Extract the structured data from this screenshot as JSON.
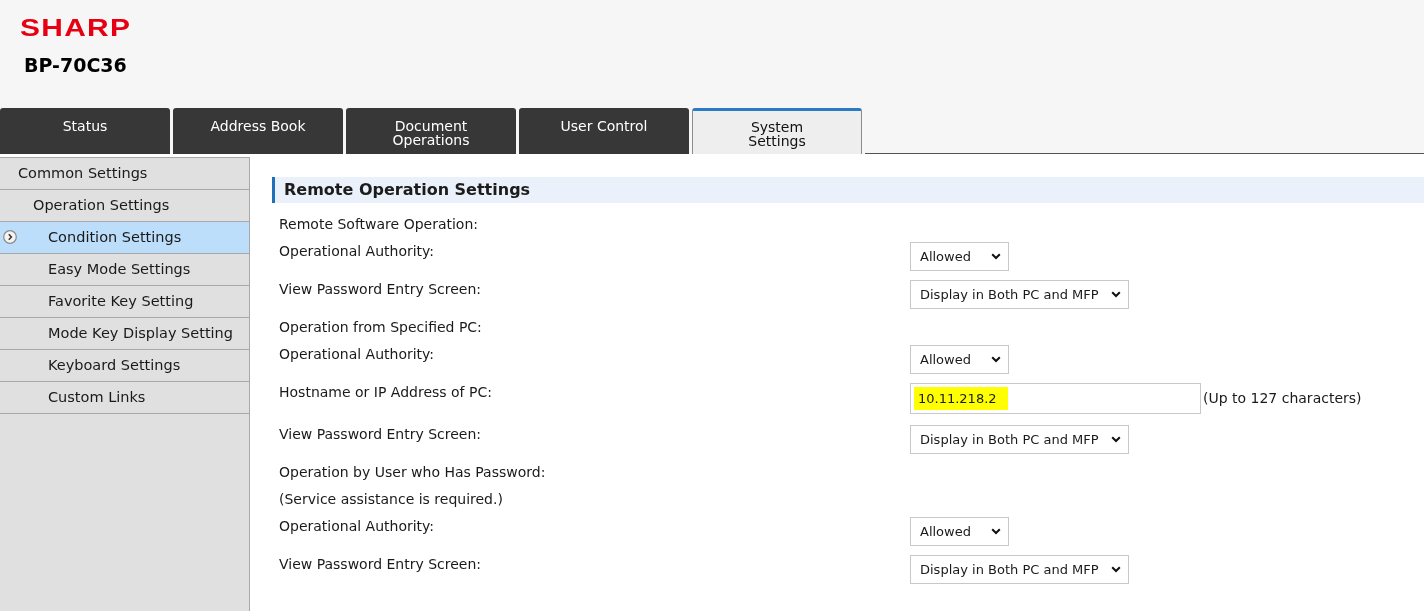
{
  "header": {
    "logo": "SHARP",
    "model": "BP-70C36"
  },
  "tabs": [
    {
      "label": "Status",
      "selected": false
    },
    {
      "label": "Address Book",
      "selected": false
    },
    {
      "label": "Document\nOperations",
      "selected": false
    },
    {
      "label": "User Control",
      "selected": false
    },
    {
      "label": "System\nSettings",
      "selected": true
    }
  ],
  "sidebar": {
    "items": [
      {
        "label": "Common Settings",
        "selected": false,
        "children": [
          {
            "label": "Operation Settings",
            "selected": false,
            "children": [
              {
                "label": "Condition Settings",
                "selected": true
              },
              {
                "label": "Easy Mode Settings",
                "selected": false
              },
              {
                "label": "Favorite Key Setting",
                "selected": false
              },
              {
                "label": "Mode Key Display Setting",
                "selected": false
              },
              {
                "label": "Keyboard Settings",
                "selected": false
              },
              {
                "label": "Custom Links",
                "selected": false
              }
            ]
          }
        ]
      }
    ]
  },
  "main": {
    "section_title": "Remote Operation Settings",
    "rows": [
      {
        "kind": "heading",
        "label": "Remote Software Operation:"
      },
      {
        "kind": "select",
        "label": "Operational Authority:",
        "value": "Allowed"
      },
      {
        "kind": "select",
        "label": "View Password Entry Screen:",
        "value": "Display in Both PC and MFP"
      },
      {
        "kind": "heading",
        "label": "Operation from Specified PC:"
      },
      {
        "kind": "select",
        "label": "Operational Authority:",
        "value": "Allowed"
      },
      {
        "kind": "text",
        "label": "Hostname or IP Address of PC:",
        "value": "10.11.218.2",
        "highlighted": true,
        "hint": "(Up to 127 characters)"
      },
      {
        "kind": "select",
        "label": "View Password Entry Screen:",
        "value": "Display in Both PC and MFP"
      },
      {
        "kind": "heading",
        "label": "Operation by User who Has Password:"
      },
      {
        "kind": "heading",
        "label": "(Service assistance is required.)"
      },
      {
        "kind": "select",
        "label": "Operational Authority:",
        "value": "Allowed"
      },
      {
        "kind": "select",
        "label": "View Password Entry Screen:",
        "value": "Display in Both PC and MFP"
      }
    ]
  }
}
